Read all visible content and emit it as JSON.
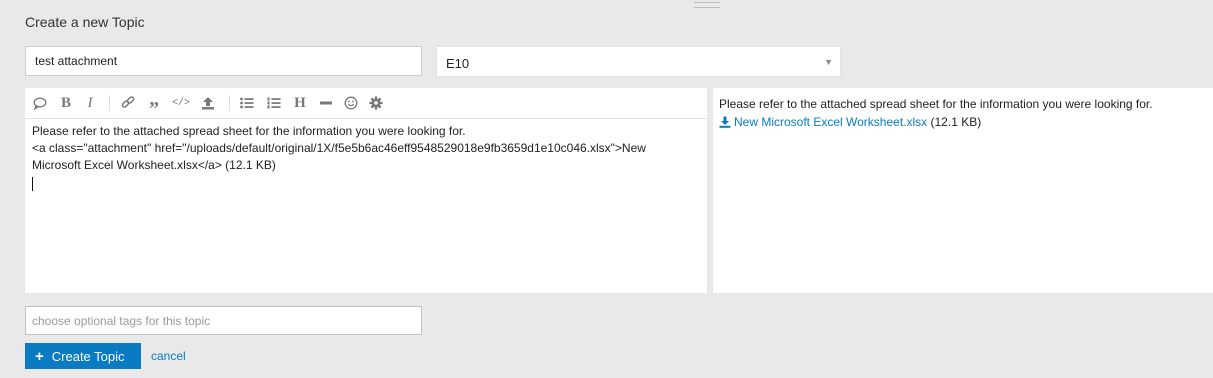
{
  "composer": {
    "heading": "Create a new Topic",
    "title_value": "test attachment",
    "category_value": "E10"
  },
  "toolbar": {
    "buttons": [
      "speech-bubble-icon",
      "bold-icon",
      "italic-icon",
      "link-icon",
      "quote-icon",
      "code-icon",
      "upload-icon",
      "bullet-list-icon",
      "numbered-list-icon",
      "heading-icon",
      "horizontal-rule-icon",
      "emoji-icon",
      "gear-icon"
    ],
    "bold_glyph": "B",
    "italic_glyph": "I",
    "quote_glyph": "”",
    "code_glyph": "</>",
    "heading_glyph": "H"
  },
  "editor": {
    "lines": [
      "Please refer to the attached spread sheet for the information you were looking for.",
      "<a class=\"attachment\" href=\"/uploads/default/original/1X/f5e5b6ac46eff9548529018e9fb3659d1e10c046.xlsx\">New",
      "Microsoft Excel Worksheet.xlsx</a> (12.1 KB)"
    ]
  },
  "preview": {
    "text": "Please refer to the attached spread sheet for the information you were looking for.",
    "attachment_name": "New Microsoft Excel Worksheet.xlsx",
    "attachment_size": "(12.1 KB)"
  },
  "tags": {
    "placeholder": "choose optional tags for this topic"
  },
  "actions": {
    "create_label": "Create Topic",
    "create_glyph": "+",
    "cancel_label": "cancel"
  },
  "colors": {
    "accent": "#0a7bc2",
    "link": "#0a7bbe",
    "background": "#e9e9e9"
  }
}
